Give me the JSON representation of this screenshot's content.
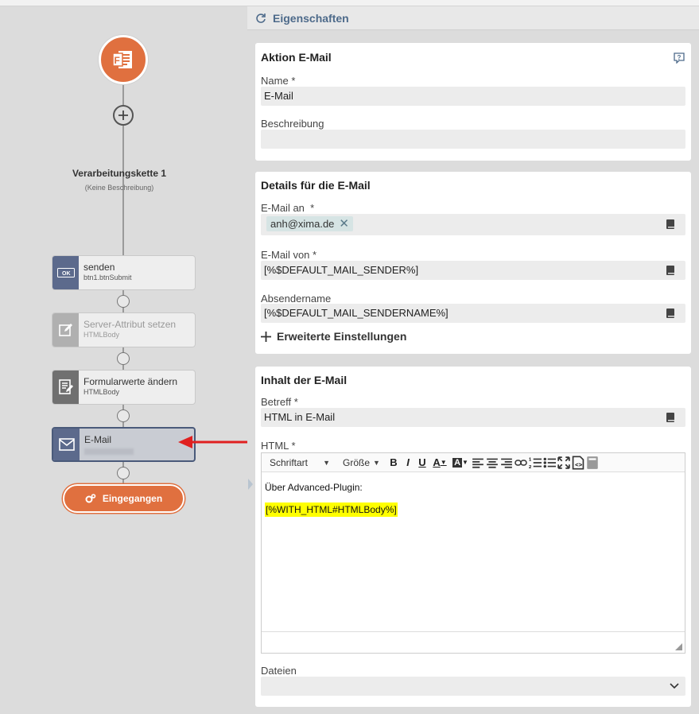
{
  "left": {
    "chain_title": "Verarbeitungskette 1",
    "chain_subtitle": "(Keine Beschreibung)",
    "nodes": [
      {
        "title": "senden",
        "subtitle": "btn1.btnSubmit",
        "icon": "ok-button-icon",
        "icon_bg": "#5c6a8c"
      },
      {
        "title": "Server-Attribut setzen",
        "subtitle": "HTMLBody",
        "icon": "edit-icon",
        "icon_bg": "#b0b0b0"
      },
      {
        "title": "Formularwerte ändern",
        "subtitle": "HTMLBody",
        "icon": "form-edit-icon",
        "icon_bg": "#707070"
      },
      {
        "title": "E-Mail",
        "subtitle": "",
        "icon": "mail-icon",
        "icon_bg": "#5c6a8c"
      }
    ],
    "end_label": "Eingegangen",
    "start_icon": "xima-form-logo-icon",
    "accent": "#e0703f"
  },
  "right": {
    "header_title": "Eigenschaften",
    "card1": {
      "title": "Aktion E-Mail",
      "name_label": "Name",
      "name_value": "E-Mail",
      "desc_label": "Beschreibung",
      "desc_value": ""
    },
    "card2": {
      "title": "Details für die E-Mail",
      "to_label": "E-Mail an",
      "to_tag": "anh@xima.de",
      "from_label": "E-Mail von",
      "from_value": "[%$DEFAULT_MAIL_SENDER%]",
      "sender_label": "Absendername",
      "sender_value": "[%$DEFAULT_MAIL_SENDERNAME%]",
      "advanced_label": "Erweiterte Einstellungen"
    },
    "card3": {
      "title": "Inhalt der E-Mail",
      "subject_label": "Betreff",
      "subject_value": "HTML in E-Mail",
      "html_label": "HTML",
      "toolbar_font": "Schriftart",
      "toolbar_size": "Größe",
      "body_line1": "Über Advanced-Plugin:",
      "body_line2": "[%WITH_HTML#HTMLBody%]",
      "files_label": "Dateien"
    },
    "required_mark": "*"
  }
}
